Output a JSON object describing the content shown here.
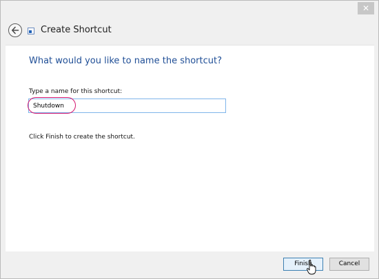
{
  "window": {
    "close_glyph": "✕"
  },
  "header": {
    "title": "Create Shortcut",
    "back_icon": "back-arrow-icon",
    "shortcut_icon": "shortcut-icon"
  },
  "main": {
    "question": "What would you like to name the shortcut?",
    "name_label": "Type a name for this shortcut:",
    "name_value": "Shutdown",
    "finish_hint": "Click Finish to create the shortcut."
  },
  "footer": {
    "finish_label": "Finish",
    "cancel_label": "Cancel"
  },
  "colors": {
    "accent": "#1f4e96",
    "highlight": "#d4146e",
    "input_border": "#7eb4ea"
  }
}
